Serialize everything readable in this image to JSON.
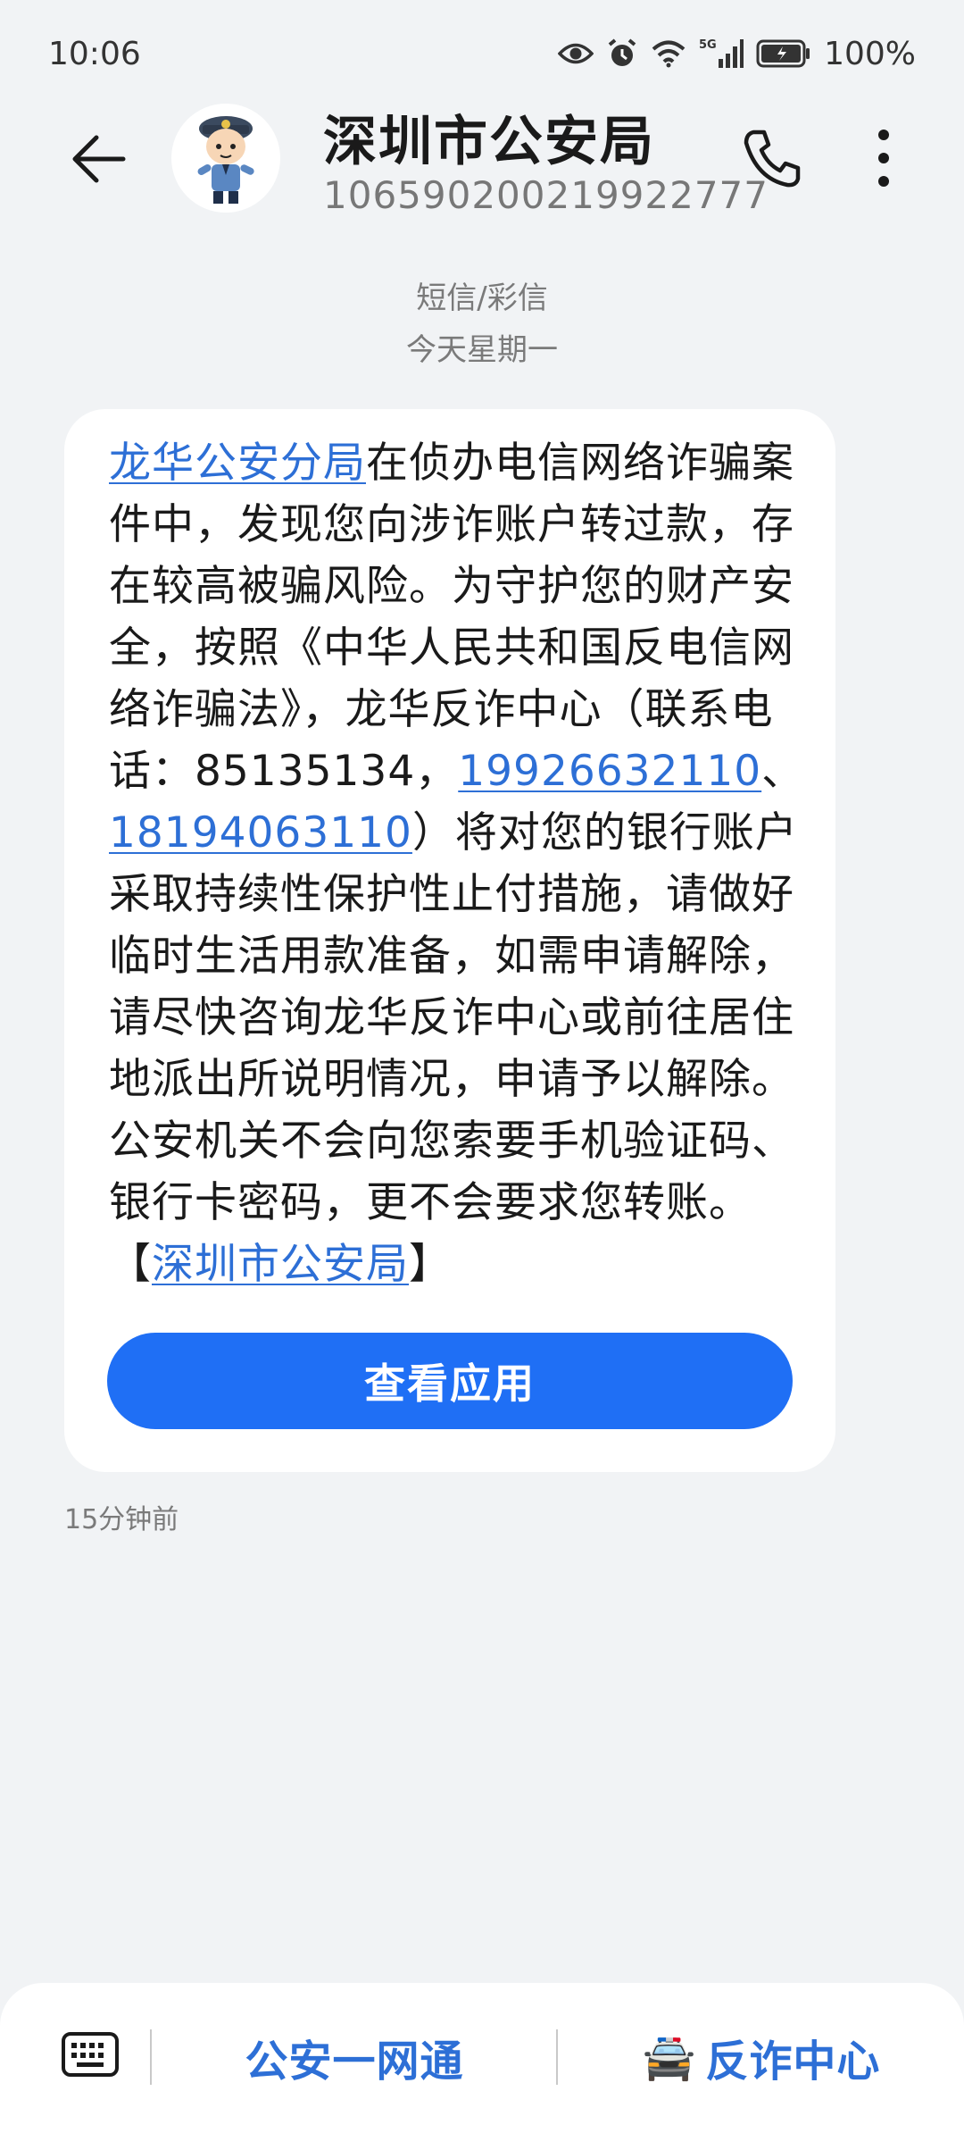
{
  "status_bar": {
    "time": "10:06",
    "battery": "100%",
    "icons": [
      "eye-icon",
      "alarm-icon",
      "wifi-icon",
      "signal-5g-icon",
      "battery-icon"
    ]
  },
  "header": {
    "contact_name": "深圳市公安局",
    "contact_number": "10659020021992​2777",
    "icons": [
      "back-arrow-icon",
      "police-avatar",
      "phone-icon",
      "more-icon"
    ]
  },
  "conversation": {
    "message_type": "短信/彩信",
    "date": "今天星期一"
  },
  "message": {
    "link_station": "龙华公安分局",
    "text_1": "在侦办电信网络诈骗案件中，发现您向涉诈账户转过款，存在较高被骗风险。为守护您的财产安全，按照《中华人民共和国反电信网络诈骗法》，龙华反诈中心（联系电话：85135134，",
    "link_phone_1": "19926632110",
    "sep": "、",
    "link_phone_2": "18194063110",
    "text_2": "）将对您的银行账户采取持续性保护性止付措施，请做好临时生活用款准备，如需申请解除，请尽快咨询龙华反诈中心或前往居住地派出所说明情况，申请予以解除。公安机关不会向您索要手机验证码、银行卡密码，更不会要求您转账。",
    "bracket_open": "【",
    "link_sender": "深圳市公安局",
    "bracket_close": "】",
    "button_label": "查看应用",
    "time": "15分钟前"
  },
  "bottom_menu": {
    "item_1": "公安一网通",
    "item_2": "反诈中心",
    "item_2_emoji": "🚔",
    "icons": [
      "keyboard-icon"
    ]
  }
}
